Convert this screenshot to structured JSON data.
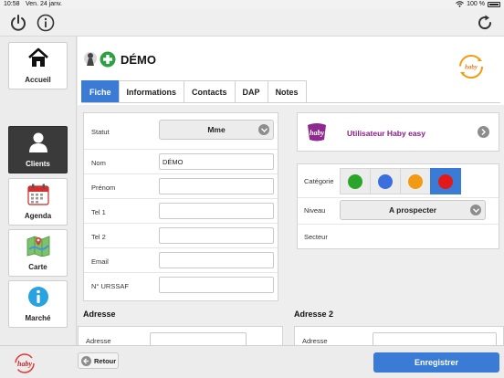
{
  "status_bar": {
    "time": "10:58",
    "date": "Ven. 24 janv.",
    "battery": "100 %"
  },
  "header": {
    "title": "DÉMO"
  },
  "tabs": [
    {
      "label": "Fiche",
      "active": true
    },
    {
      "label": "Informations",
      "active": false
    },
    {
      "label": "Contacts",
      "active": false
    },
    {
      "label": "DAP",
      "active": false
    },
    {
      "label": "Notes",
      "active": false
    }
  ],
  "sidebar": {
    "items": [
      {
        "label": "Accueil",
        "icon": "home-icon",
        "active": false
      },
      {
        "label": "Clients",
        "icon": "user-icon",
        "active": true
      },
      {
        "label": "Agenda",
        "icon": "calendar-icon",
        "active": false
      },
      {
        "label": "Carte",
        "icon": "map-icon",
        "active": false
      },
      {
        "label": "Marché",
        "icon": "info-icon",
        "active": false
      }
    ]
  },
  "form": {
    "statut": {
      "label": "Statut",
      "value": "Mme"
    },
    "nom": {
      "label": "Nom",
      "value": "DÉMO"
    },
    "prenom": {
      "label": "Prénom",
      "value": ""
    },
    "tel1": {
      "label": "Tel 1",
      "value": ""
    },
    "tel2": {
      "label": "Tel 2",
      "value": ""
    },
    "email": {
      "label": "Email",
      "value": ""
    },
    "urssaf": {
      "label": "N° URSSAF",
      "value": ""
    }
  },
  "user": {
    "name": "Utilisateur Haby easy",
    "logo_text": "haby"
  },
  "classification": {
    "categorie_label": "Catégorie",
    "colors": [
      "#2aa52a",
      "#3a6fe0",
      "#f29a12",
      "#e31818"
    ],
    "selected_index": 3,
    "niveau_label": "Niveau",
    "niveau_value": "A prospecter",
    "secteur_label": "Secteur"
  },
  "adresse": {
    "title": "Adresse",
    "field_label": "Adresse"
  },
  "adresse2": {
    "title": "Adresse 2",
    "field_label": "Adresse"
  },
  "footer": {
    "back_label": "Retour",
    "save_label": "Enregistrer",
    "logo_text": "haby"
  }
}
